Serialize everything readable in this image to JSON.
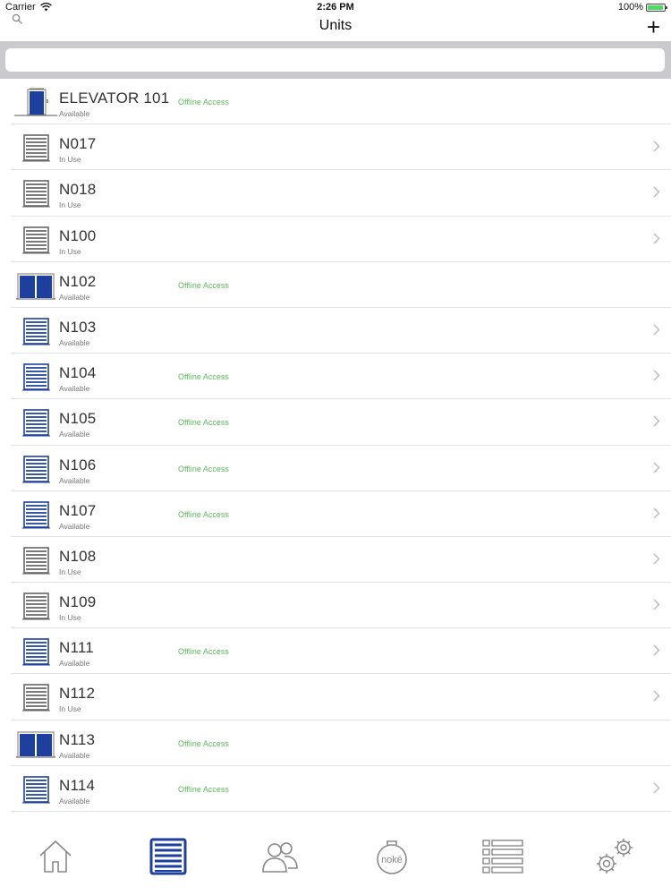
{
  "status_bar": {
    "carrier": "Carrier",
    "time": "2:26 PM",
    "battery": "100%"
  },
  "nav": {
    "title": "Units",
    "add_label": "+"
  },
  "search": {
    "placeholder": ""
  },
  "units": [
    {
      "name": "ELEVATOR 101",
      "status": "Available",
      "offline": "Offline Access",
      "icon": "elevator-icon",
      "chevron": false
    },
    {
      "name": "N017",
      "status": "In Use",
      "offline": "",
      "icon": "roll-door-gray-icon",
      "chevron": true
    },
    {
      "name": "N018",
      "status": "In Use",
      "offline": "",
      "icon": "roll-door-gray-icon",
      "chevron": true
    },
    {
      "name": "N100",
      "status": "In Use",
      "offline": "",
      "icon": "roll-door-gray-icon",
      "chevron": true
    },
    {
      "name": "N102",
      "status": "Available",
      "offline": "Offline Access",
      "icon": "double-door-blue-icon",
      "chevron": false
    },
    {
      "name": "N103",
      "status": "Available",
      "offline": "",
      "icon": "roll-door-blue-icon",
      "chevron": true
    },
    {
      "name": "N104",
      "status": "Available",
      "offline": "Offline Access",
      "icon": "roll-door-blue-icon",
      "chevron": true
    },
    {
      "name": "N105",
      "status": "Available",
      "offline": "Offline Access",
      "icon": "roll-door-blue-icon",
      "chevron": true
    },
    {
      "name": "N106",
      "status": "Available",
      "offline": "Offline Access",
      "icon": "roll-door-blue-icon",
      "chevron": true
    },
    {
      "name": "N107",
      "status": "Available",
      "offline": "Offline Access",
      "icon": "roll-door-blue-icon",
      "chevron": true
    },
    {
      "name": "N108",
      "status": "In Use",
      "offline": "",
      "icon": "roll-door-gray-icon",
      "chevron": true
    },
    {
      "name": "N109",
      "status": "In Use",
      "offline": "",
      "icon": "roll-door-gray-icon",
      "chevron": true
    },
    {
      "name": "N111",
      "status": "Available",
      "offline": "Offline Access",
      "icon": "roll-door-blue-icon",
      "chevron": true
    },
    {
      "name": "N112",
      "status": "In Use",
      "offline": "",
      "icon": "roll-door-gray-icon",
      "chevron": true
    },
    {
      "name": "N113",
      "status": "Available",
      "offline": "Offline Access",
      "icon": "double-door-blue-icon",
      "chevron": false
    },
    {
      "name": "N114",
      "status": "Available",
      "offline": "Offline Access",
      "icon": "roll-door-blue-icon",
      "chevron": true
    }
  ],
  "tab_bar": {
    "tabs": [
      {
        "id": "home",
        "icon": "home-icon",
        "selected": false
      },
      {
        "id": "units",
        "icon": "units-icon",
        "selected": true
      },
      {
        "id": "users",
        "icon": "users-icon",
        "selected": false
      },
      {
        "id": "noke",
        "icon": "noke-lock-icon",
        "label": "nokē",
        "selected": false
      },
      {
        "id": "activity",
        "icon": "list-icon",
        "selected": false
      },
      {
        "id": "settings",
        "icon": "gear-icon",
        "selected": false
      }
    ]
  },
  "colors": {
    "accent_blue": "#1d3f9e",
    "icon_gray": "#555555",
    "offline_green": "#5cb85c",
    "search_band": "#c9c9ce"
  }
}
